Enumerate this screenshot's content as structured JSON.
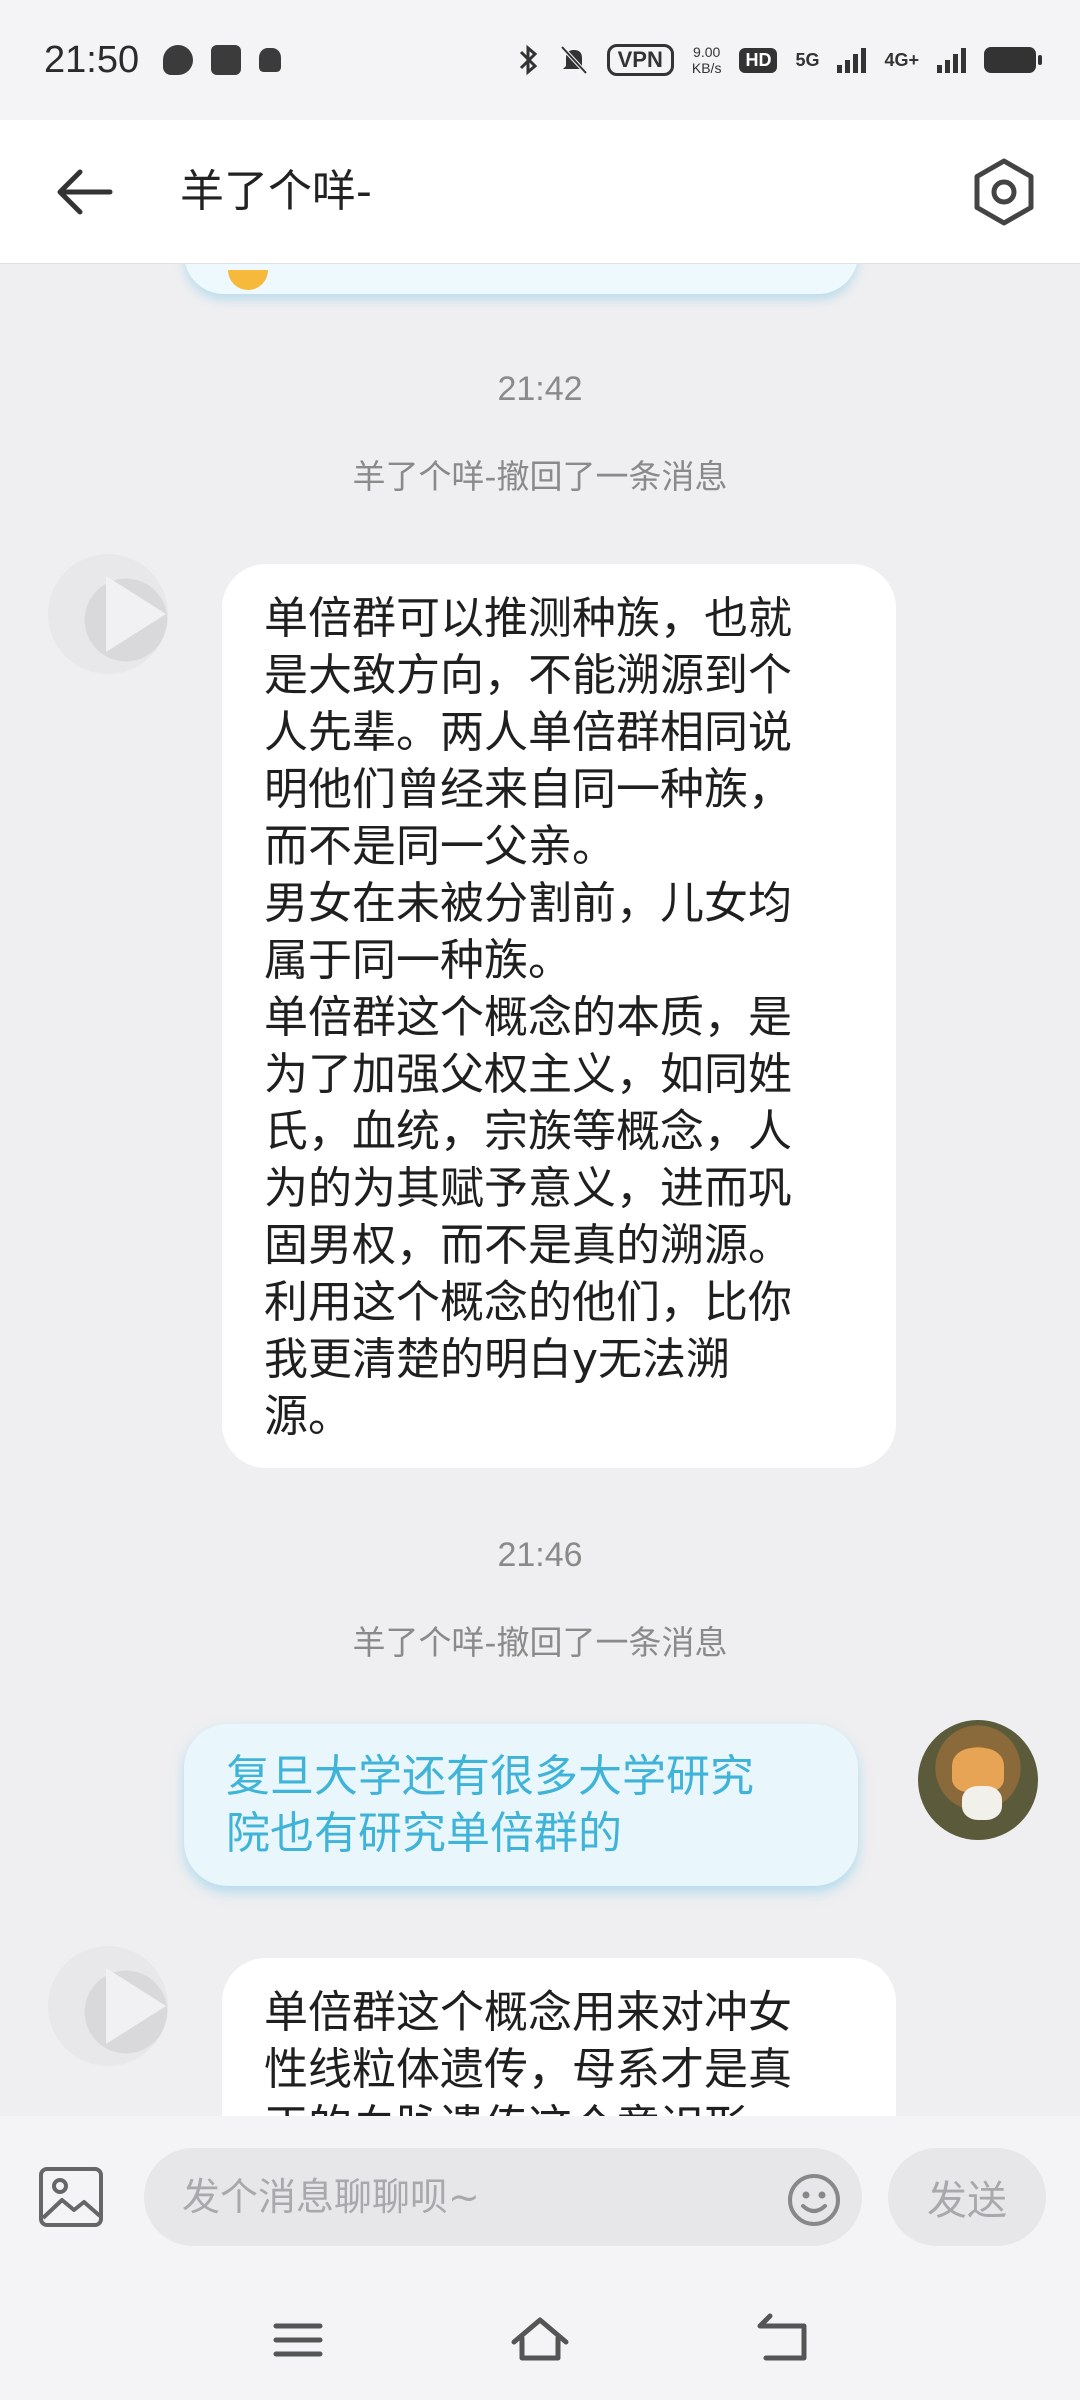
{
  "status_bar": {
    "time": "21:50",
    "vpn": "VPN",
    "speed_value": "9.00",
    "speed_unit": "KB/s",
    "hd": "HD",
    "net1": "5G",
    "net2": "4G+"
  },
  "header": {
    "title": "羊了个咩-"
  },
  "messages": {
    "ts1": "21:42",
    "sys1": "羊了个咩-撤回了一条消息",
    "bubble1": "单倍群可以推测种族，也就\n是大致方向，不能溯源到个\n人先辈。两人单倍群相同说\n明他们曾经来自同一种族，\n而不是同一父亲。\n男女在未被分割前，儿女均\n属于同一种族。\n单倍群这个概念的本质，是\n为了加强父权主义，如同姓\n氏，血统，宗族等概念，人\n为的为其赋予意义，进而巩\n固男权，而不是真的溯源。\n利用这个概念的他们，比你\n我更清楚的明白y无法溯\n源。",
    "ts2": "21:46",
    "sys2": "羊了个咩-撤回了一条消息",
    "bubble2": "复旦大学还有很多大学研究\n院也有研究单倍群的",
    "bubble3": "单倍群这个概念用来对冲女\n性线粒体遗传，母系才是真\n正的血脉遗传这个意识形"
  },
  "input_bar": {
    "placeholder": "发个消息聊聊呗~",
    "send_label": "发送"
  },
  "icons": {
    "back": "back-arrow-icon",
    "settings": "hexagon-settings-icon",
    "image": "image-icon",
    "emoji": "emoji-icon",
    "menu": "menu-icon",
    "home": "home-icon",
    "return": "return-icon"
  },
  "colors": {
    "accent_text": "#3fb3d8",
    "outgoing_bubble": "#e9f7fc",
    "incoming_bubble": "#ffffff",
    "background": "#efeff1"
  }
}
